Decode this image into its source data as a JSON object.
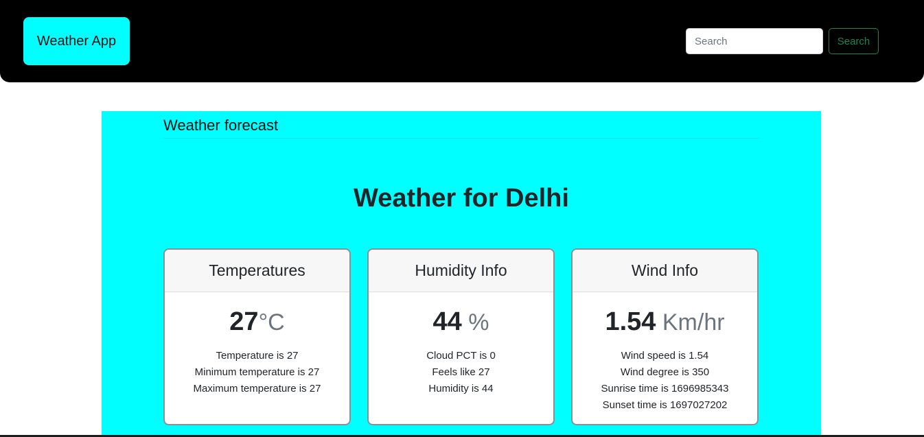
{
  "navbar": {
    "brand": "Weather App",
    "search_placeholder": "Search",
    "search_button": "Search"
  },
  "main": {
    "section_title": "Weather forecast",
    "headline": "Weather for Delhi",
    "cards": {
      "temperature": {
        "header": "Temperatures",
        "value": "27",
        "unit": "°C",
        "lines": [
          "Temperature is 27",
          "Minimum temperature is 27",
          "Maximum temperature is 27"
        ]
      },
      "humidity": {
        "header": "Humidity Info",
        "value": "44",
        "unit": " %",
        "lines": [
          "Cloud PCT is 0",
          "Feels like 27",
          "Humidity is 44"
        ]
      },
      "wind": {
        "header": "Wind Info",
        "value": "1.54",
        "unit": " Km/hr",
        "lines": [
          "Wind speed is 1.54",
          "Wind degree is 350",
          "Sunrise time is 1696985343",
          "Sunset time is 1697027202"
        ]
      }
    }
  },
  "colors": {
    "navbar_bg": "#000000",
    "brand_bg": "#00ffff",
    "main_bg": "#00ffff",
    "search_button_outline": "#198754"
  }
}
